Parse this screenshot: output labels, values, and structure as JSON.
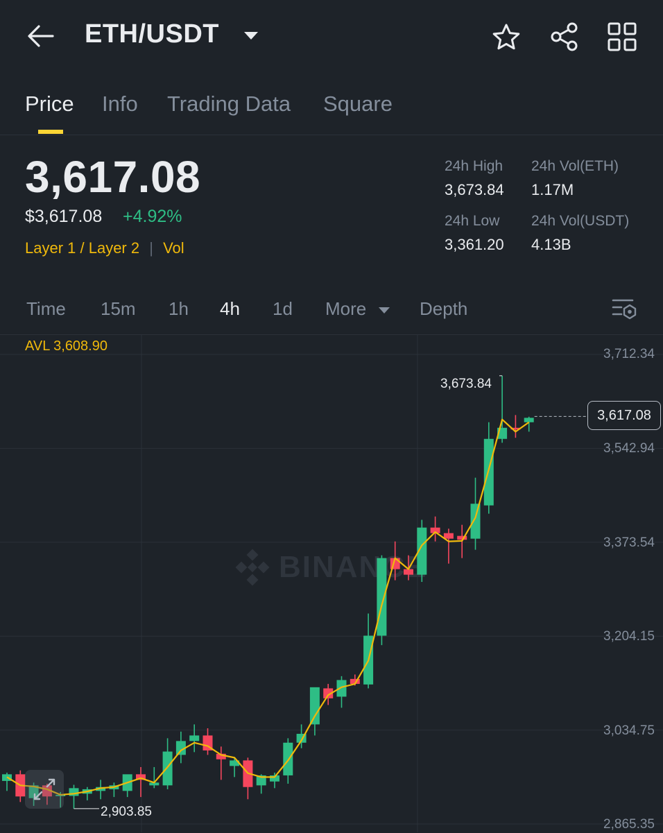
{
  "header": {
    "back_icon": "arrow-left-icon",
    "pair": "ETH/USDT",
    "dropdown_icon": "caret-down-icon",
    "favorite_icon": "star-icon",
    "share_icon": "share-icon",
    "more_icon": "grid-icon"
  },
  "tabs": [
    {
      "label": "Price",
      "active": true
    },
    {
      "label": "Info",
      "active": false
    },
    {
      "label": "Trading Data",
      "active": false
    },
    {
      "label": "Square",
      "active": false
    }
  ],
  "price": {
    "last": "3,617.08",
    "usd": "$3,617.08",
    "change": "+4.92%",
    "tag1": "Layer 1 / Layer 2",
    "tag2": "Vol"
  },
  "stats": {
    "high_label": "24h High",
    "high": "3,673.84",
    "vol_eth_label": "24h Vol(ETH)",
    "vol_eth": "1.17M",
    "low_label": "24h Low",
    "low": "3,361.20",
    "vol_usdt_label": "24h Vol(USDT)",
    "vol_usdt": "4.13B"
  },
  "intervals": [
    {
      "label": "Time",
      "active": false
    },
    {
      "label": "15m",
      "active": false
    },
    {
      "label": "1h",
      "active": false
    },
    {
      "label": "4h",
      "active": true
    },
    {
      "label": "1d",
      "active": false
    },
    {
      "label": "More",
      "active": false
    },
    {
      "label": "Depth",
      "active": false
    }
  ],
  "chart": {
    "avl_text": "AVL 3,608.90",
    "axis_labels": [
      "3,712.34",
      "3,542.94",
      "3,373.54",
      "3,204.15",
      "3,034.75",
      "2,865.35"
    ],
    "current_price": "3,617.08",
    "high_marker": "3,673.84",
    "low_marker": "2,903.85",
    "watermark": "BINANCE",
    "settings_icon": "chart-settings-icon",
    "colors": {
      "up": "#2ebd85",
      "down": "#f6465d",
      "ma": "#f0b90b",
      "grid": "#2b3139"
    }
  },
  "chart_data": {
    "type": "candlestick",
    "interval": "4h",
    "ylim": [
      2865.35,
      3712.34
    ],
    "yticks": [
      3712.34,
      3542.94,
      3373.54,
      3204.15,
      3034.75,
      2865.35
    ],
    "candles": [
      {
        "o": 2943,
        "h": 2958,
        "l": 2925,
        "c": 2955
      },
      {
        "o": 2955,
        "h": 2962,
        "l": 2905,
        "c": 2915
      },
      {
        "o": 2912,
        "h": 2940,
        "l": 2898,
        "c": 2935
      },
      {
        "o": 2935,
        "h": 2938,
        "l": 2900,
        "c": 2915
      },
      {
        "o": 2918,
        "h": 2923,
        "l": 2895,
        "c": 2918
      },
      {
        "o": 2916,
        "h": 2936,
        "l": 2893,
        "c": 2930
      },
      {
        "o": 2920,
        "h": 2932,
        "l": 2908,
        "c": 2928
      },
      {
        "o": 2925,
        "h": 2945,
        "l": 2910,
        "c": 2932
      },
      {
        "o": 2928,
        "h": 2940,
        "l": 2914,
        "c": 2935
      },
      {
        "o": 2925,
        "h": 2950,
        "l": 2914,
        "c": 2955
      },
      {
        "o": 2955,
        "h": 2968,
        "l": 2914,
        "c": 2945
      },
      {
        "o": 2935,
        "h": 2968,
        "l": 2930,
        "c": 2940
      },
      {
        "o": 2935,
        "h": 3020,
        "l": 2928,
        "c": 2996
      },
      {
        "o": 2990,
        "h": 3032,
        "l": 2975,
        "c": 3015
      },
      {
        "o": 3015,
        "h": 3045,
        "l": 2995,
        "c": 3025
      },
      {
        "o": 3025,
        "h": 3038,
        "l": 2990,
        "c": 2998
      },
      {
        "o": 2992,
        "h": 3005,
        "l": 2945,
        "c": 2982
      },
      {
        "o": 2970,
        "h": 2985,
        "l": 2950,
        "c": 2980
      },
      {
        "o": 2980,
        "h": 2985,
        "l": 2910,
        "c": 2932
      },
      {
        "o": 2935,
        "h": 2955,
        "l": 2920,
        "c": 2953
      },
      {
        "o": 2942,
        "h": 2958,
        "l": 2930,
        "c": 2953
      },
      {
        "o": 2953,
        "h": 3020,
        "l": 2938,
        "c": 3012
      },
      {
        "o": 3012,
        "h": 3045,
        "l": 3002,
        "c": 3028
      },
      {
        "o": 3045,
        "h": 3105,
        "l": 3025,
        "c": 3112
      },
      {
        "o": 3110,
        "h": 3118,
        "l": 3080,
        "c": 3092
      },
      {
        "o": 3095,
        "h": 3132,
        "l": 3075,
        "c": 3125
      },
      {
        "o": 3127,
        "h": 3135,
        "l": 3115,
        "c": 3118
      },
      {
        "o": 3117,
        "h": 3245,
        "l": 3110,
        "c": 3205
      },
      {
        "o": 3205,
        "h": 3350,
        "l": 3188,
        "c": 3345
      },
      {
        "o": 3345,
        "h": 3375,
        "l": 3305,
        "c": 3325
      },
      {
        "o": 3325,
        "h": 3350,
        "l": 3305,
        "c": 3315
      },
      {
        "o": 3315,
        "h": 3414,
        "l": 3302,
        "c": 3400
      },
      {
        "o": 3400,
        "h": 3420,
        "l": 3375,
        "c": 3390
      },
      {
        "o": 3390,
        "h": 3398,
        "l": 3335,
        "c": 3380
      },
      {
        "o": 3385,
        "h": 3405,
        "l": 3345,
        "c": 3378
      },
      {
        "o": 3380,
        "h": 3490,
        "l": 3360,
        "c": 3443
      },
      {
        "o": 3440,
        "h": 3590,
        "l": 3425,
        "c": 3560
      },
      {
        "o": 3560,
        "h": 3673.84,
        "l": 3553,
        "c": 3580
      },
      {
        "o": 3580,
        "h": 3603,
        "l": 3562,
        "c": 3577
      },
      {
        "o": 3590,
        "h": 3600,
        "l": 3573,
        "c": 3598
      }
    ],
    "ma": [
      2950,
      2935,
      2933,
      2928,
      2918,
      2920,
      2924,
      2930,
      2932,
      2940,
      2948,
      2940,
      2968,
      2998,
      3012,
      3006,
      2990,
      2985,
      2957,
      2950,
      2950,
      2980,
      3016,
      3060,
      3098,
      3112,
      3118,
      3160,
      3260,
      3345,
      3325,
      3368,
      3392,
      3375,
      3376,
      3418,
      3505,
      3595,
      3573,
      3590
    ]
  }
}
